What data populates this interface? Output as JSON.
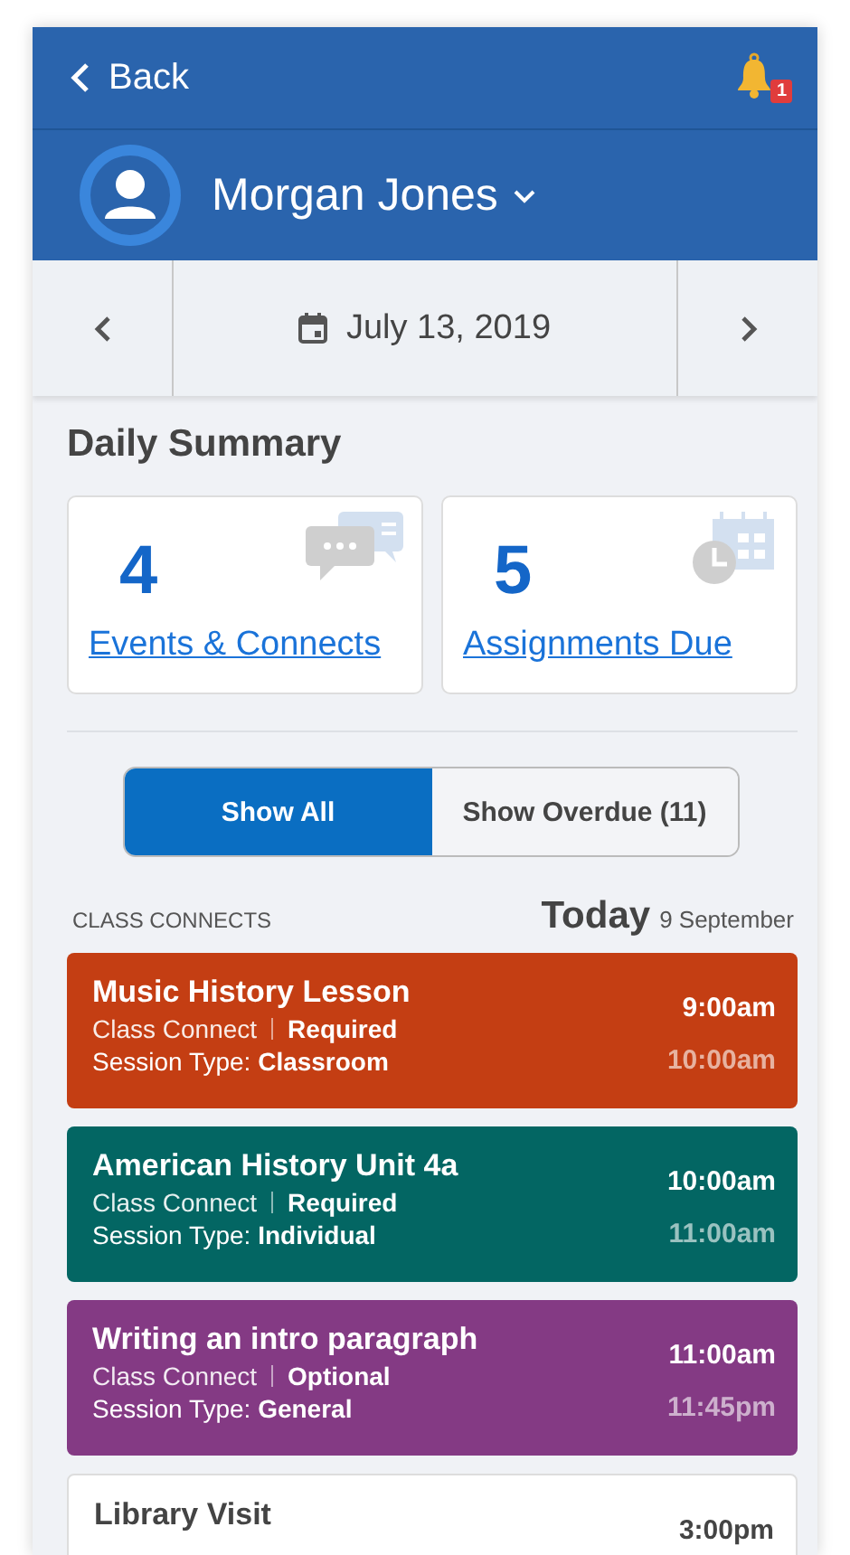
{
  "header": {
    "back_label": "Back",
    "notification_count": "1"
  },
  "profile": {
    "name": "Morgan Jones"
  },
  "date_nav": {
    "date": "July 13, 2019"
  },
  "summary": {
    "title": "Daily Summary",
    "tiles": [
      {
        "count": "4",
        "label": "Events & Connects",
        "kind": "chat"
      },
      {
        "count": "5",
        "label": "Assignments Due",
        "kind": "calendar"
      }
    ]
  },
  "filters": [
    {
      "label": "Show All",
      "selected": true
    },
    {
      "label": "Show Overdue (11)",
      "selected": false
    }
  ],
  "section": {
    "title": "CLASS CONNECTS",
    "day": "Today",
    "date": "9 September"
  },
  "events": [
    {
      "title": "Music History Lesson",
      "category": "Class Connect",
      "requirement": "Required",
      "session": "Session Type: **Classroom**",
      "start": "9:00am",
      "end": "10:00am",
      "color": "#c43e13"
    },
    {
      "title": "American History Unit 4a",
      "category": "Class Connect",
      "requirement": "Required",
      "session": "Session Type: **Individual**",
      "start": "10:00am",
      "end": "11:00am",
      "color": "#036663"
    },
    {
      "title": "Writing an intro paragraph",
      "category": "Class Connect",
      "requirement": "Optional",
      "session": "Session Type: **General**",
      "start": "11:00am",
      "end": "11:45pm",
      "color": "#843a84"
    },
    {
      "title": "Library Visit",
      "start": "3:00pm",
      "color": "#ffffff"
    }
  ]
}
